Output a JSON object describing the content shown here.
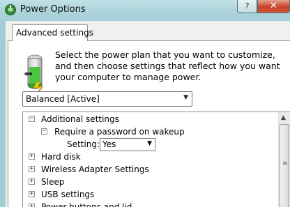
{
  "window": {
    "title": "Power Options",
    "help_label": "?",
    "close_label": "✕"
  },
  "tabs": [
    {
      "label": "Advanced settings",
      "active": true
    }
  ],
  "description": "Select the power plan that you want to customize, and then choose settings that reflect how you want your computer to manage power.",
  "plan_select": {
    "value": "Balanced [Active]"
  },
  "settings_tree": [
    {
      "label": "Additional settings",
      "expanded": true,
      "expander": "⊟"
    },
    {
      "label": "Require a password on wakeup",
      "expanded": true,
      "expander": "⊟"
    },
    {
      "label": "Hard disk",
      "expanded": false,
      "expander": "⊞"
    },
    {
      "label": "Wireless Adapter Settings",
      "expanded": false,
      "expander": "⊞"
    },
    {
      "label": "Sleep",
      "expanded": false,
      "expander": "⊞"
    },
    {
      "label": "USB settings",
      "expanded": false,
      "expander": "⊞"
    },
    {
      "label": "Power buttons and lid",
      "expanded": false,
      "expander": "⊞"
    }
  ],
  "setting_field": {
    "label": "Setting:",
    "value": "Yes"
  },
  "icons": {
    "app": "power-options-icon",
    "battery": "battery-plug-icon"
  },
  "colors": {
    "close_button": "#c7432a",
    "frame": "#a3cdd5"
  }
}
